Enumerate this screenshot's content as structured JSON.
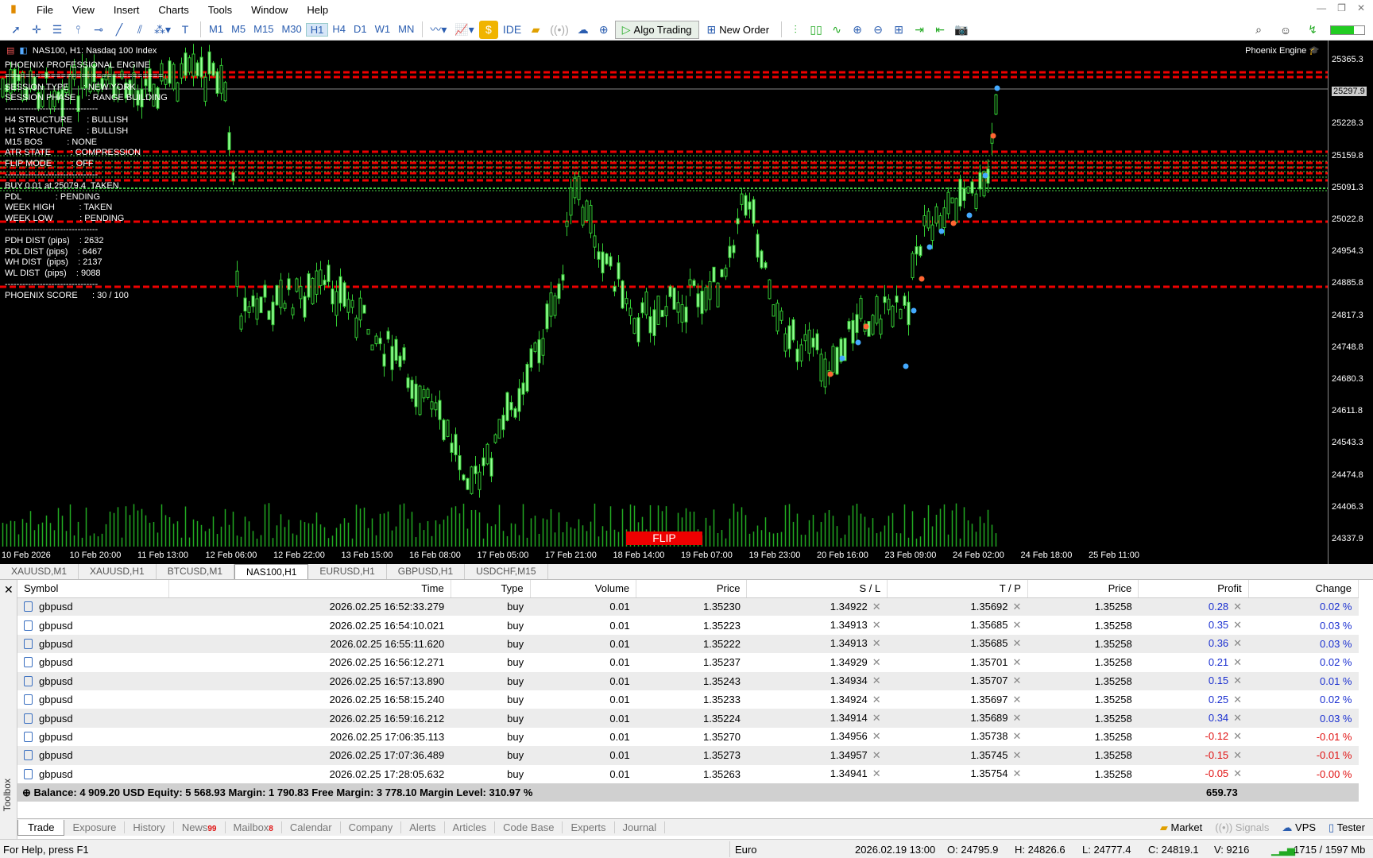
{
  "menu": [
    "File",
    "View",
    "Insert",
    "Charts",
    "Tools",
    "Window",
    "Help"
  ],
  "toolbar": {
    "timeframes": [
      "M1",
      "M5",
      "M15",
      "M30",
      "H1",
      "H4",
      "D1",
      "W1",
      "MN"
    ],
    "active_tf": "H1",
    "ide": "IDE",
    "algo": "Algo Trading",
    "new_order": "New Order"
  },
  "chart": {
    "title": "NAS100, H1:  Nasdaq 100 Index",
    "engine": "Phoenix Engine",
    "flip": "FLIP",
    "overlay": [
      "PHOENIX PROFESSIONAL ENGINE",
      "===============================",
      "SESSION TYPE      : NEW YORK",
      "SESSION PHASE     : RANGE BUILDING",
      "--------------------------------",
      "H4 STRUCTURE      : BULLISH",
      "H1 STRUCTURE      : BULLISH",
      "M15 BOS          : NONE",
      "ATR STATE        : COMPRESSION",
      "FLIP MODE        : OFF",
      "--------------------------------",
      "BUY 0.01 at 25079.4  TAKEN",
      "PDL              : PENDING",
      "WEEK HIGH          : TAKEN",
      "WEEK LOW           : PENDING",
      "--------------------------------",
      "PDH DIST (pips)    : 2632",
      "PDL DIST (pips)    : 6467",
      "WH DIST  (pips)    : 2137",
      "WL DIST  (pips)    : 9088",
      "--------------------------------",
      "PHOENIX SCORE      : 30 / 100"
    ],
    "prices": [
      "25365.3",
      "25297.9",
      "25228.3",
      "25159.8",
      "25091.3",
      "25022.8",
      "24954.3",
      "24885.8",
      "24817.3",
      "24748.8",
      "24680.3",
      "24611.8",
      "24543.3",
      "24474.8",
      "24406.3",
      "24337.9"
    ],
    "current_price": "25297.9",
    "times": [
      "10 Feb 2026",
      "10 Feb 20:00",
      "11 Feb 13:00",
      "12 Feb 06:00",
      "12 Feb 22:00",
      "13 Feb 15:00",
      "16 Feb 08:00",
      "17 Feb 05:00",
      "17 Feb 21:00",
      "18 Feb 14:00",
      "19 Feb 07:00",
      "19 Feb 23:00",
      "20 Feb 16:00",
      "23 Feb 09:00",
      "24 Feb 02:00",
      "24 Feb 18:00",
      "25 Feb 11:00"
    ]
  },
  "chart_tabs": [
    "XAUUSD,M1",
    "XAUUSD,H1",
    "BTCUSD,M1",
    "NAS100,H1",
    "EURUSD,H1",
    "GBPUSD,H1",
    "USDCHF,M15"
  ],
  "active_chart_tab": "NAS100,H1",
  "trade": {
    "columns": [
      "Symbol",
      "Time",
      "Type",
      "Volume",
      "Price",
      "S / L",
      "T / P",
      "Price",
      "Profit",
      "Change"
    ],
    "rows": [
      [
        "gbpusd",
        "2026.02.25 16:52:33.279",
        "buy",
        "0.01",
        "1.35230",
        "1.34922",
        "1.35692",
        "1.35258",
        "0.28",
        "0.02 %"
      ],
      [
        "gbpusd",
        "2026.02.25 16:54:10.021",
        "buy",
        "0.01",
        "1.35223",
        "1.34913",
        "1.35685",
        "1.35258",
        "0.35",
        "0.03 %"
      ],
      [
        "gbpusd",
        "2026.02.25 16:55:11.620",
        "buy",
        "0.01",
        "1.35222",
        "1.34913",
        "1.35685",
        "1.35258",
        "0.36",
        "0.03 %"
      ],
      [
        "gbpusd",
        "2026.02.25 16:56:12.271",
        "buy",
        "0.01",
        "1.35237",
        "1.34929",
        "1.35701",
        "1.35258",
        "0.21",
        "0.02 %"
      ],
      [
        "gbpusd",
        "2026.02.25 16:57:13.890",
        "buy",
        "0.01",
        "1.35243",
        "1.34934",
        "1.35707",
        "1.35258",
        "0.15",
        "0.01 %"
      ],
      [
        "gbpusd",
        "2026.02.25 16:58:15.240",
        "buy",
        "0.01",
        "1.35233",
        "1.34924",
        "1.35697",
        "1.35258",
        "0.25",
        "0.02 %"
      ],
      [
        "gbpusd",
        "2026.02.25 16:59:16.212",
        "buy",
        "0.01",
        "1.35224",
        "1.34914",
        "1.35689",
        "1.35258",
        "0.34",
        "0.03 %"
      ],
      [
        "gbpusd",
        "2026.02.25 17:06:35.113",
        "buy",
        "0.01",
        "1.35270",
        "1.34956",
        "1.35738",
        "1.35258",
        "-0.12",
        "-0.01 %"
      ],
      [
        "gbpusd",
        "2026.02.25 17:07:36.489",
        "buy",
        "0.01",
        "1.35273",
        "1.34957",
        "1.35745",
        "1.35258",
        "-0.15",
        "-0.01 %"
      ],
      [
        "gbpusd",
        "2026.02.25 17:28:05.632",
        "buy",
        "0.01",
        "1.35263",
        "1.34941",
        "1.35754",
        "1.35258",
        "-0.05",
        "-0.00 %"
      ]
    ],
    "balance": "Balance: 4 909.20 USD  Equity: 5 568.93  Margin: 1 790.83  Free Margin: 3 778.10  Margin Level: 310.97 %",
    "total_profit": "659.73"
  },
  "toolbox_label": "Toolbox",
  "bottom_tabs": [
    {
      "label": "Trade"
    },
    {
      "label": "Exposure"
    },
    {
      "label": "History"
    },
    {
      "label": "News",
      "badge": "99"
    },
    {
      "label": "Mailbox",
      "badge": "8"
    },
    {
      "label": "Calendar"
    },
    {
      "label": "Company"
    },
    {
      "label": "Alerts"
    },
    {
      "label": "Articles"
    },
    {
      "label": "Code Base"
    },
    {
      "label": "Experts"
    },
    {
      "label": "Journal"
    }
  ],
  "right_tabs": [
    "Market",
    "Signals",
    "VPS",
    "Tester"
  ],
  "status": {
    "help": "For Help, press F1",
    "profile": "Euro",
    "datetime": "2026.02.19 13:00",
    "open": "O: 24795.9",
    "high": "H: 24826.6",
    "low": "L: 24777.4",
    "close": "C: 24819.1",
    "volume": "V: 9216",
    "memory": "1715 / 1597 Mb"
  }
}
